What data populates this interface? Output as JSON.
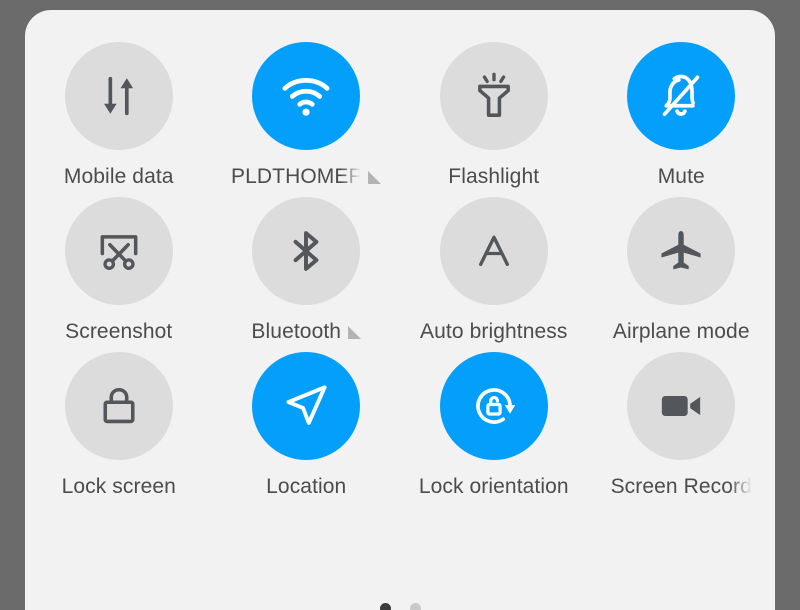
{
  "panel": {
    "background_color": "#f2f2f2",
    "screen_background_color": "#6b6b6b",
    "accent_color": "#039ffb",
    "inactive_tile_color": "#dcdcdc",
    "label_color": "#4c4c4c"
  },
  "tiles": [
    {
      "label": "Mobile data",
      "icon": "mobile-data-icon",
      "state": "off",
      "expandable": false
    },
    {
      "label": "PLDTHOMEF",
      "icon": "wifi-icon",
      "state": "on",
      "expandable": true,
      "truncated": true
    },
    {
      "label": "Flashlight",
      "icon": "flashlight-icon",
      "state": "off",
      "expandable": false
    },
    {
      "label": "Mute",
      "icon": "bell-off-icon",
      "state": "on",
      "expandable": false
    },
    {
      "label": "Screenshot",
      "icon": "screenshot-icon",
      "state": "off",
      "expandable": false
    },
    {
      "label": "Bluetooth",
      "icon": "bluetooth-icon",
      "state": "off",
      "expandable": true
    },
    {
      "label": "Auto brightness",
      "icon": "auto-brightness-icon",
      "state": "off",
      "expandable": false
    },
    {
      "label": "Airplane mode",
      "icon": "airplane-icon",
      "state": "off",
      "expandable": false
    },
    {
      "label": "Lock screen",
      "icon": "lock-icon",
      "state": "off",
      "expandable": false
    },
    {
      "label": "Location",
      "icon": "location-arrow-icon",
      "state": "on",
      "expandable": false
    },
    {
      "label": "Lock orientation",
      "icon": "lock-rotation-icon",
      "state": "on",
      "expandable": false
    },
    {
      "label": "Screen Record",
      "icon": "video-camera-icon",
      "state": "off",
      "expandable": false,
      "truncated": true
    }
  ],
  "pagination": {
    "total_pages": 2,
    "current_page": 1
  }
}
